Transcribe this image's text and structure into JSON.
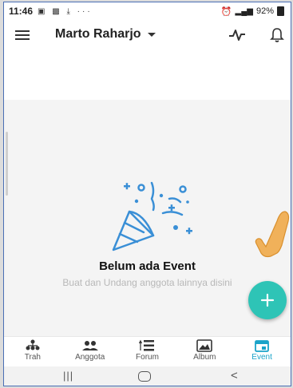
{
  "status_bar": {
    "time": "11:46",
    "left_icons": [
      "gallery-icon",
      "image-icon",
      "download-icon",
      "more-icon"
    ],
    "network": "4G",
    "battery": "92%"
  },
  "app_bar": {
    "title": "Marto Raharjo",
    "icons": [
      "menu-icon",
      "caret-down-icon",
      "activity-icon",
      "bell-icon"
    ]
  },
  "empty_state": {
    "title": "Belum ada Event",
    "subtitle": "Buat dan Undang anggota lainnya disini",
    "icon": "party-popper-icon"
  },
  "fab": {
    "icon": "plus-icon",
    "color": "#2ec4b6"
  },
  "bottom_nav": {
    "items": [
      {
        "label": "Trah",
        "icon": "family-tree-icon",
        "active": false
      },
      {
        "label": "Anggota",
        "icon": "people-icon",
        "active": false
      },
      {
        "label": "Forum",
        "icon": "forum-icon",
        "active": false
      },
      {
        "label": "Album",
        "icon": "album-icon",
        "active": false
      },
      {
        "label": "Event",
        "icon": "calendar-icon",
        "active": true
      }
    ],
    "active_color": "#1aa3c9"
  },
  "system_nav": {
    "icons": [
      "recent-apps-icon",
      "home-icon",
      "back-icon"
    ]
  },
  "colors": {
    "accent": "#2ec4b6",
    "illustration": "#3a8fd6",
    "active_tab": "#1aa3c9"
  }
}
